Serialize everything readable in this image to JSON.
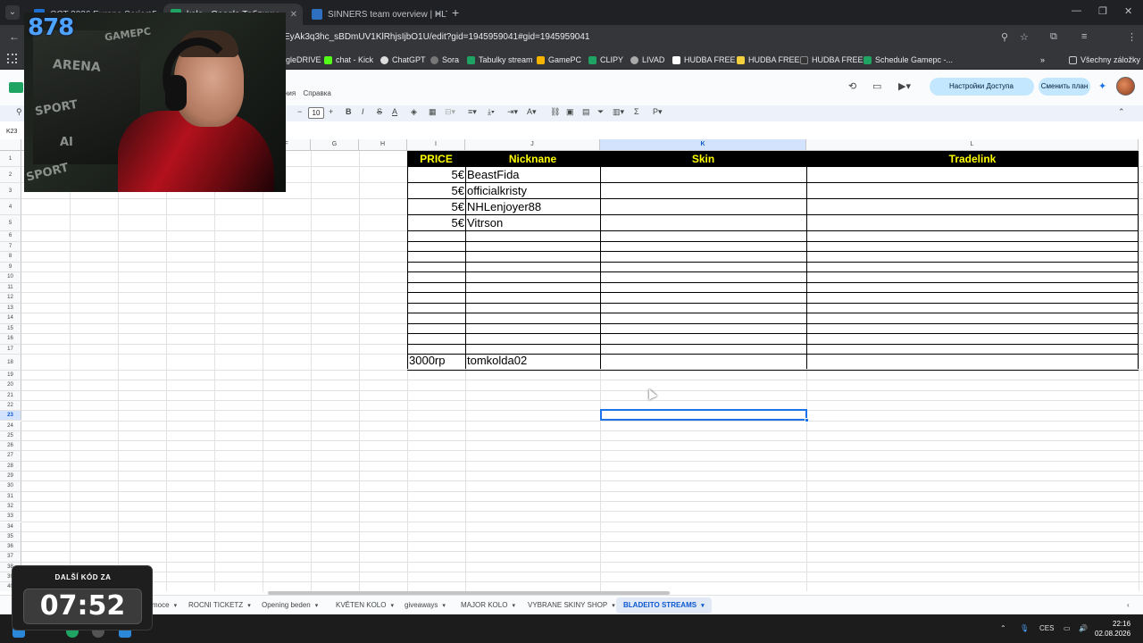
{
  "browser": {
    "tabs": [
      {
        "title": "CCT 2026 Europe Series 5 overv"
      },
      {
        "title": "kolo - Google Таблицы"
      },
      {
        "title": "SINNERS team overview | HLTV"
      }
    ],
    "url": "EyAk3q3hc_sBDmUV1KlRhjsIjbO1U/edit?gid=1945959041#gid=1945959041",
    "bookmarks": [
      "gleDRIVE",
      "chat - Kick",
      "ChatGPT",
      "Sora",
      "Tabulky stream",
      "GamePC",
      "CLIPY",
      "LIVAD",
      "HUDBA FREE",
      "HUDBA FREE",
      "HUDBA FREE",
      "Schedule Gamepc -..."
    ],
    "all_bookmarks": "Všechny záložky"
  },
  "sheets": {
    "menu_help": "Справка",
    "menu_partial": "ния",
    "share_label": "Настройки Доступа",
    "plan_label": "Сменить план",
    "font_size": "10",
    "name_box": "K23",
    "columns": [
      {
        "label": "F"
      },
      {
        "label": "G"
      },
      {
        "label": "H"
      },
      {
        "label": "I"
      },
      {
        "label": "J"
      },
      {
        "label": "K"
      },
      {
        "label": "L"
      }
    ],
    "table_headers": {
      "price": "PRICE",
      "nickname": "Nicknane",
      "skin": "Skin",
      "tradelink": "Tradelink"
    },
    "rows": [
      {
        "price": "5€",
        "nickname": "BeastFida"
      },
      {
        "price": "5€",
        "nickname": "officialkristy"
      },
      {
        "price": "5€",
        "nickname": "NHLenjoyer88"
      },
      {
        "price": "5€",
        "nickname": "Vitrson"
      }
    ],
    "row18": {
      "price": "3000rp",
      "nickname": "tomkolda02"
    },
    "sheet_tabs": [
      "moce",
      "ROCNI TICKETZ",
      "Opening beden",
      "KVĚTEN KOLO",
      "giveaways",
      "MAJOR KOLO",
      "VYBRANE SKINY SHOP",
      "BLADEITO STREAMS"
    ],
    "active_sheet": "BLADEITO STREAMS"
  },
  "overlay": {
    "viewer_badge": "878",
    "timer_label": "DALŠÍ KÓD ZA",
    "timer_value": "07:52",
    "webcam_texts": [
      "ARENA",
      "GAMEPC",
      "SPORT",
      "AI",
      "SPORT"
    ]
  },
  "taskbar": {
    "lang": "CES",
    "time": "22:16",
    "date": "02.08.2026"
  },
  "colors": {
    "header_bg": "#000000",
    "header_text": "#ffff00",
    "selection": "#1a73e8",
    "timer_bg": "#1e1e1e"
  }
}
